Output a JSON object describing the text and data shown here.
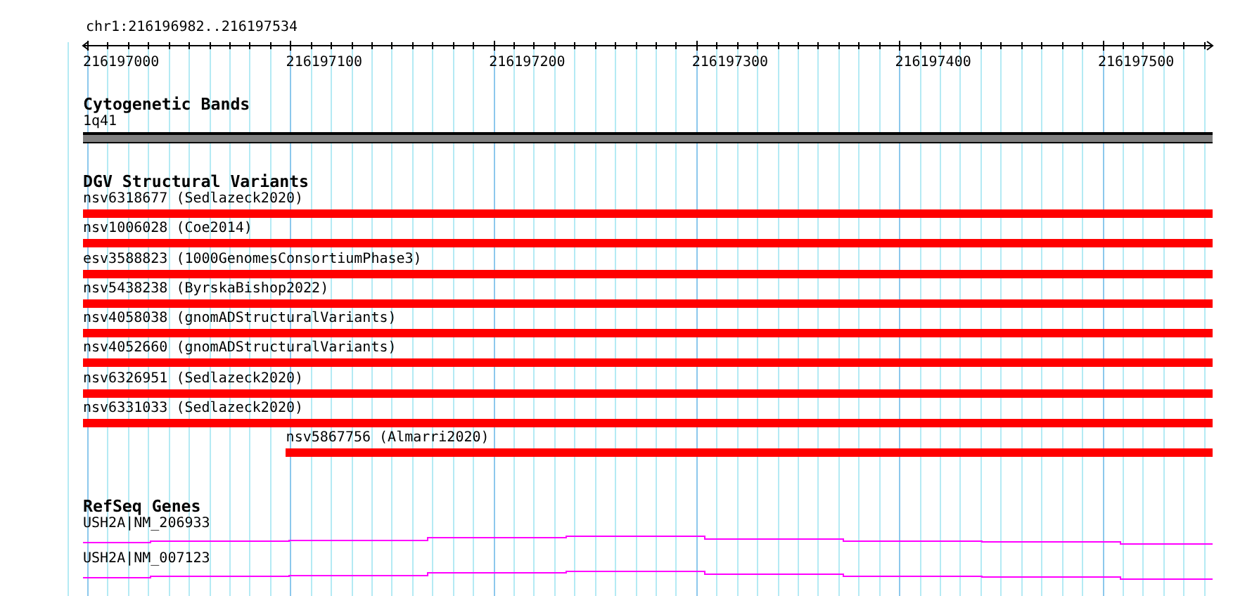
{
  "ruler": {
    "range": "chr1:216196982..216197534",
    "ticks": [
      "216197000",
      "216197100",
      "216197200",
      "216197300",
      "216197400",
      "216197500"
    ]
  },
  "tracks": [
    {
      "kind": "bands",
      "title": "Cytogenetic Bands",
      "features": [
        {
          "label": "1q41"
        }
      ]
    },
    {
      "kind": "variants",
      "title": "DGV Structural Variants",
      "features": [
        {
          "label": "nsv6318677 (Sedlazeck2020)",
          "starts_inside": false
        },
        {
          "label": "nsv1006028 (Coe2014)",
          "starts_inside": false
        },
        {
          "label": "esv3588823 (1000GenomesConsortiumPhase3)",
          "starts_inside": false
        },
        {
          "label": "nsv5438238 (ByrskaBishop2022)",
          "starts_inside": false
        },
        {
          "label": "nsv4058038 (gnomADStructuralVariants)",
          "starts_inside": false
        },
        {
          "label": "nsv4052660 (gnomADStructuralVariants)",
          "starts_inside": false
        },
        {
          "label": "nsv6326951 (Sedlazeck2020)",
          "starts_inside": false
        },
        {
          "label": "nsv6331033 (Sedlazeck2020)",
          "starts_inside": false
        },
        {
          "label": "nsv5867756 (Almarri2020)",
          "starts_inside": true
        }
      ]
    },
    {
      "kind": "genes",
      "title": "RefSeq Genes",
      "features": [
        {
          "label": "USH2A|NM_206933"
        },
        {
          "label": "USH2A|NM_007123"
        }
      ]
    }
  ]
}
